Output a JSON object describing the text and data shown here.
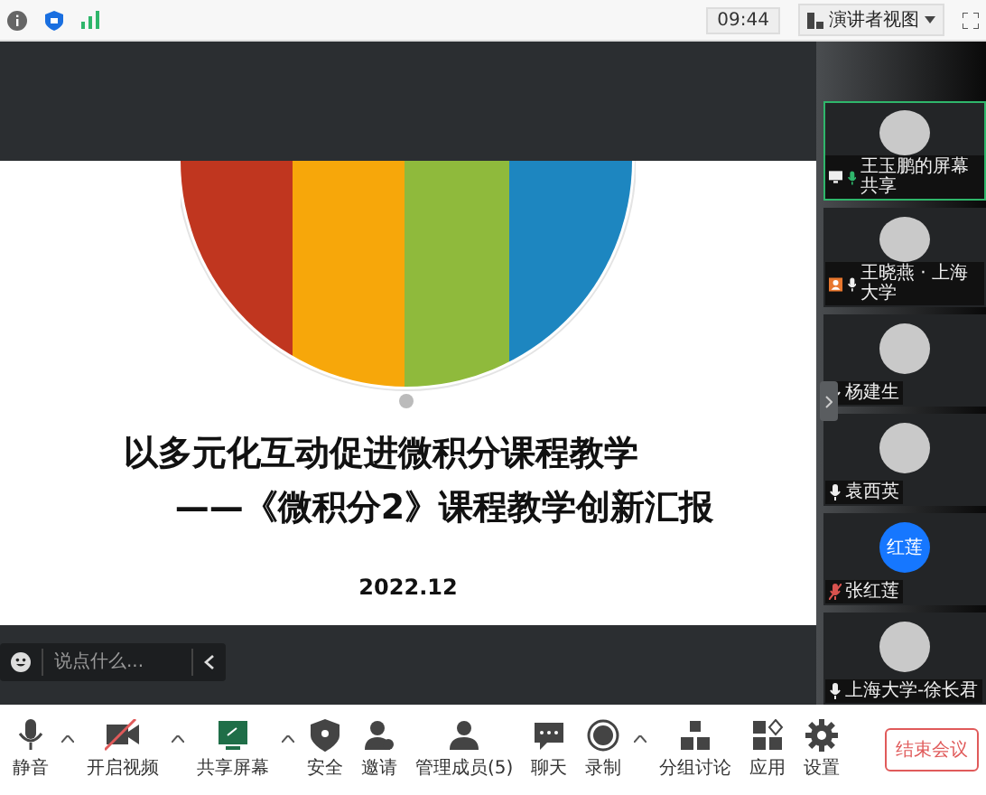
{
  "status_bar": {
    "time": "09:44",
    "view_button": "演讲者视图"
  },
  "slide": {
    "title_line_1": "以多元化互动促进微积分课程教学",
    "title_line_2": "——《微积分2》课程教学创新汇报",
    "date": "2022.12"
  },
  "chat": {
    "placeholder": "说点什么..."
  },
  "participants": [
    {
      "name": "王玉鹏的屏幕共享",
      "active": true,
      "sharing": true,
      "host": false,
      "muted": false
    },
    {
      "name": "王晓燕 · 上海大学",
      "active": false,
      "sharing": false,
      "host": true,
      "muted": false
    },
    {
      "name": "杨建生",
      "active": false,
      "sharing": false,
      "host": false,
      "muted": false
    },
    {
      "name": "袁西英",
      "active": false,
      "sharing": false,
      "host": false,
      "muted": false
    },
    {
      "name": "张红莲",
      "active": false,
      "sharing": false,
      "host": false,
      "muted": true,
      "avatar_text": "红莲"
    },
    {
      "name": "上海大学-徐长君",
      "active": false,
      "sharing": false,
      "host": false,
      "muted": false
    }
  ],
  "toolbar": [
    {
      "kind": "mic",
      "label": "静音",
      "has_menu": true
    },
    {
      "kind": "video",
      "label": "开启视频",
      "has_menu": true,
      "on": false
    },
    {
      "kind": "share",
      "label": "共享屏幕",
      "has_menu": true
    },
    {
      "kind": "security",
      "label": "安全",
      "has_menu": false
    },
    {
      "kind": "invite",
      "label": "邀请",
      "has_menu": false
    },
    {
      "kind": "members",
      "label": "管理成员(5)",
      "has_menu": false
    },
    {
      "kind": "chat",
      "label": "聊天",
      "has_menu": false
    },
    {
      "kind": "record",
      "label": "录制",
      "has_menu": true
    },
    {
      "kind": "breakout",
      "label": "分组讨论",
      "has_menu": false
    },
    {
      "kind": "apps",
      "label": "应用",
      "has_menu": false
    },
    {
      "kind": "settings",
      "label": "设置",
      "has_menu": false
    }
  ],
  "end_button": "结束会议"
}
